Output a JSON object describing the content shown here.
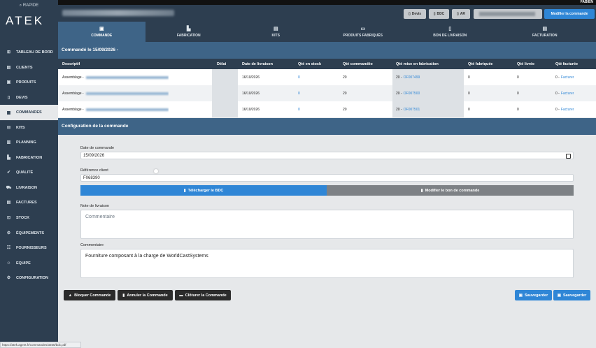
{
  "topbar": {
    "user": "FABIEN"
  },
  "sidebar": {
    "rapide": "RAPIDE",
    "logo": "ATEK",
    "items": [
      {
        "label": "TABLEAU DE BORD",
        "icon": "chart-icon",
        "glyph": "⊞"
      },
      {
        "label": "CLIENTS",
        "icon": "contact-card-icon",
        "glyph": "▤"
      },
      {
        "label": "PRODUITS",
        "icon": "products-icon",
        "glyph": "▣"
      },
      {
        "label": "DEVIS",
        "icon": "document-icon",
        "glyph": "▯"
      },
      {
        "label": "COMMANDES",
        "icon": "orders-icon",
        "glyph": "▦"
      },
      {
        "label": "KITS",
        "icon": "kits-icon",
        "glyph": "⊟"
      },
      {
        "label": "PLANNING",
        "icon": "calendar-icon",
        "glyph": "▥"
      },
      {
        "label": "FABRICATION",
        "icon": "factory-icon",
        "glyph": "▙"
      },
      {
        "label": "QUALITÉ",
        "icon": "quality-icon",
        "glyph": "✔"
      },
      {
        "label": "LIVRAISON",
        "icon": "truck-icon",
        "glyph": "⛟"
      },
      {
        "label": "FACTURES",
        "icon": "invoice-icon",
        "glyph": "▤"
      },
      {
        "label": "STOCK",
        "icon": "stock-icon",
        "glyph": "⊡"
      },
      {
        "label": "ÉQUIPEMENTS",
        "icon": "equipment-icon",
        "glyph": "⚙"
      },
      {
        "label": "FOURNISSEURS",
        "icon": "suppliers-icon",
        "glyph": "☷"
      },
      {
        "label": "EQUIPE",
        "icon": "team-icon",
        "glyph": "☺"
      },
      {
        "label": "CONFIGURATION",
        "icon": "config-icon",
        "glyph": "⚙"
      }
    ]
  },
  "header": {
    "devis": "Devis",
    "bdc": "BDC",
    "ar": "AR",
    "modifier": "Modifier la commande"
  },
  "tabs": [
    {
      "label": "COMMANDE",
      "icon": "order-icon",
      "glyph": "▣"
    },
    {
      "label": "FABRICATION",
      "icon": "factory-icon",
      "glyph": "▙"
    },
    {
      "label": "KITS",
      "icon": "kits-icon",
      "glyph": "▤"
    },
    {
      "label": "PRODUITS FABRIQUÉS",
      "icon": "products-icon",
      "glyph": "▭"
    },
    {
      "label": "BON DE LIVRAISON",
      "icon": "delivery-note-icon",
      "glyph": "▯"
    },
    {
      "label": "FACTURATION",
      "icon": "invoice-icon",
      "glyph": "▤"
    }
  ],
  "order_title": "Commandé le 15/09/2026 -",
  "table": {
    "headers": [
      "Descriptif",
      "Délai",
      "Date de livraison",
      "Qté en stock",
      "Qté commandée",
      "Qté mise en fabrication",
      "Qté fabriquée",
      "Qté livrée",
      "Qté facturée"
    ],
    "rows": [
      {
        "desc": "Assemblage -",
        "date": "16/10/2026",
        "stock": "0",
        "commandee": "20",
        "fab_qty": "20 -",
        "fab_ref": "OF007499",
        "fabriquee": "0",
        "livree": "0",
        "facturee": "0 -",
        "facturer": "Facturer"
      },
      {
        "desc": "Assemblage -",
        "date": "16/10/2026",
        "stock": "0",
        "commandee": "20",
        "fab_qty": "20 -",
        "fab_ref": "OF007500",
        "fabriquee": "0",
        "livree": "0",
        "facturee": "0 -",
        "facturer": "Facturer"
      },
      {
        "desc": "Assemblage -",
        "date": "16/10/2026",
        "stock": "0",
        "commandee": "20",
        "fab_qty": "20 -",
        "fab_ref": "OF007501",
        "fabriquee": "0",
        "livree": "0",
        "facturee": "0 -",
        "facturer": "Facturer"
      }
    ]
  },
  "config": {
    "title": "Configuration de la commande",
    "date_label": "Date de commande",
    "date_value": "15/09/2026",
    "ref_label": "Référence client",
    "ref_value": "F068390",
    "btn_download": "Télécharger le BDC",
    "btn_modify": "Modifier le bon de commande",
    "note_label": "Note de livraison",
    "note_placeholder": "Commentaire",
    "comment_label": "Commentaire",
    "comment_value": "Fourniture composant à la charge de WorldCastSystems"
  },
  "actions": {
    "bloquer": "Bloquer Commande",
    "annuler": "Annuler la Commande",
    "cloturer": "Clôturer la Commande",
    "sauvegarder1": "Sauvegarder",
    "sauvegarder2": "Sauvegarder"
  },
  "colors": {
    "sidebar": "#2d3e50",
    "accent": "#2f86d6",
    "section": "#3e6487",
    "disabled": "#7d8185"
  },
  "status_url": "https://atek.agent.fr/commandes/3255/bdc.pdf"
}
